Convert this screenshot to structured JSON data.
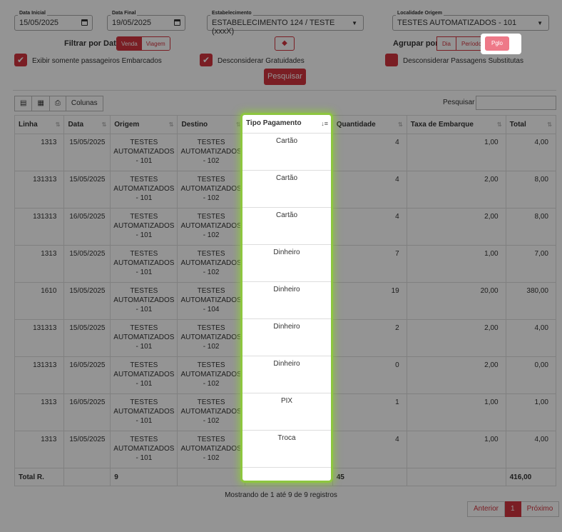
{
  "filters": {
    "data_inicial": {
      "label": "Data Inicial",
      "value": "15/05/2025"
    },
    "data_final": {
      "label": "Data Final",
      "value": "19/05/2025"
    },
    "estabelecimento": {
      "label": "Estabelecimento",
      "value": "ESTABELECIMENTO 124 / TESTE (xxxX)"
    },
    "localidade_origem": {
      "label": "Localidade Origem",
      "value": "TESTES AUTOMATIZADOS - 101"
    },
    "filtrar_por_data": {
      "label": "Filtrar por Data:",
      "options": [
        "Venda",
        "Viagem"
      ],
      "selected": "Venda"
    },
    "agrupar_por": {
      "label": "Agrupar por:",
      "options": [
        "Dia",
        "Período",
        "Pglo"
      ],
      "selected": "Pglo"
    },
    "checkboxes": [
      {
        "label": "Exibir somente passageiros Embarcados",
        "checked": true
      },
      {
        "label": "Desconsiderar Gratuidades",
        "checked": true
      },
      {
        "label": "Desconsiderar Passagens Substitutas",
        "checked": false
      }
    ],
    "pesquisar_label": "Pesquisar"
  },
  "toolbar": {
    "colunas_label": "Colunas",
    "search_label": "Pesquisar",
    "search_value": ""
  },
  "table": {
    "headers": [
      "Linha",
      "Data",
      "Origem",
      "Destino",
      "Tipo Pagamento",
      "Quantidade",
      "Taxa de Embarque",
      "Total"
    ],
    "rows": [
      [
        "1313",
        "15/05/2025",
        "TESTES AUTOMATIZADOS - 101",
        "TESTES AUTOMATIZADOS - 102",
        "Cartão",
        "4",
        "1,00",
        "4,00"
      ],
      [
        "131313",
        "15/05/2025",
        "TESTES AUTOMATIZADOS - 101",
        "TESTES AUTOMATIZADOS - 102",
        "Cartão",
        "4",
        "2,00",
        "8,00"
      ],
      [
        "131313",
        "16/05/2025",
        "TESTES AUTOMATIZADOS - 101",
        "TESTES AUTOMATIZADOS - 102",
        "Cartão",
        "4",
        "2,00",
        "8,00"
      ],
      [
        "1313",
        "15/05/2025",
        "TESTES AUTOMATIZADOS - 101",
        "TESTES AUTOMATIZADOS - 102",
        "Dinheiro",
        "7",
        "1,00",
        "7,00"
      ],
      [
        "1610",
        "15/05/2025",
        "TESTES AUTOMATIZADOS - 101",
        "TESTES AUTOMATIZADOS - 104",
        "Dinheiro",
        "19",
        "20,00",
        "380,00"
      ],
      [
        "131313",
        "15/05/2025",
        "TESTES AUTOMATIZADOS - 101",
        "TESTES AUTOMATIZADOS - 102",
        "Dinheiro",
        "2",
        "2,00",
        "4,00"
      ],
      [
        "131313",
        "16/05/2025",
        "TESTES AUTOMATIZADOS - 101",
        "TESTES AUTOMATIZADOS - 102",
        "Dinheiro",
        "0",
        "2,00",
        "0,00"
      ],
      [
        "1313",
        "16/05/2025",
        "TESTES AUTOMATIZADOS - 101",
        "TESTES AUTOMATIZADOS - 102",
        "PIX",
        "1",
        "1,00",
        "1,00"
      ],
      [
        "1313",
        "15/05/2025",
        "TESTES AUTOMATIZADOS - 101",
        "TESTES AUTOMATIZADOS - 102",
        "Troca",
        "4",
        "1,00",
        "4,00"
      ]
    ],
    "footer": {
      "label": "Total R.",
      "origem": "9",
      "quantidade": "45",
      "total": "416,00"
    }
  },
  "info": "Mostrando de 1 até 9 de 9 registros",
  "pagination": {
    "prev": "Anterior",
    "page": "1",
    "next": "Próximo"
  },
  "colors": {
    "accent": "#d3343e",
    "highlight": "#8dc63f"
  }
}
